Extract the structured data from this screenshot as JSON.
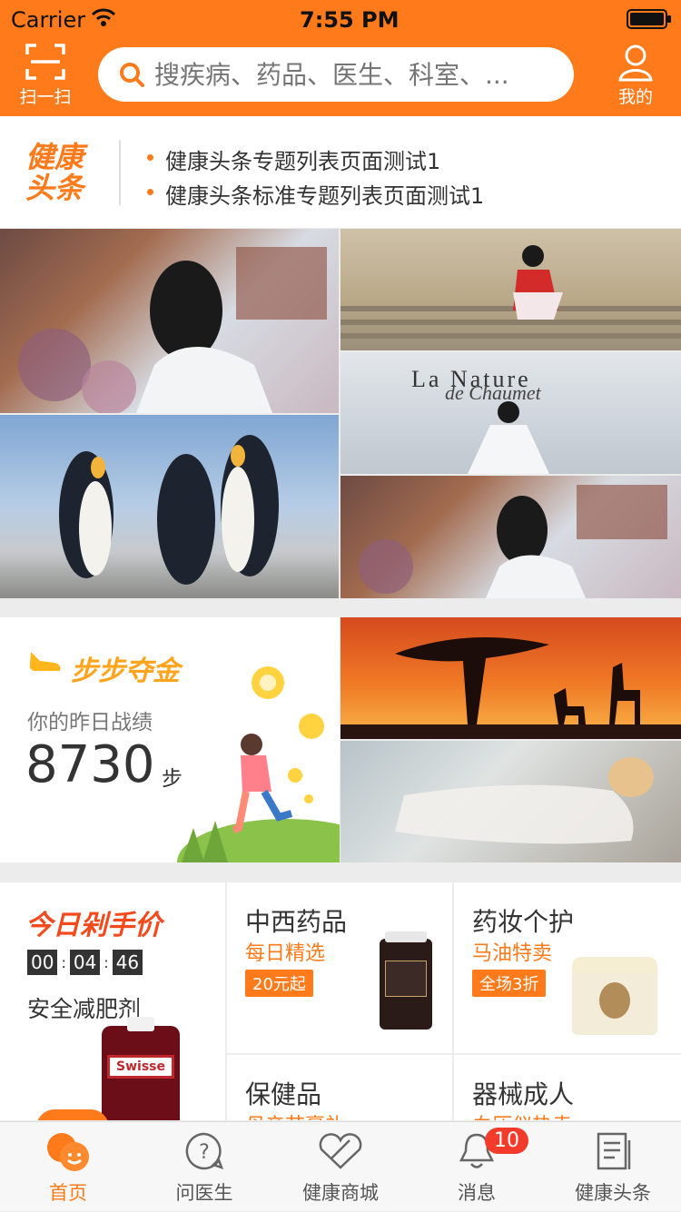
{
  "status_bar": {
    "carrier": "Carrier",
    "time": "7:55 PM"
  },
  "header": {
    "scan_label": "扫一扫",
    "search_placeholder": "搜疾病、药品、医生、科室、...",
    "profile_label": "我的"
  },
  "headline": {
    "logo_text": "健康头条",
    "items": [
      "健康头条专题列表页面测试1",
      "健康头条标准专题列表页面测试1"
    ]
  },
  "steps": {
    "title": "步步夺金",
    "subtitle": "你的昨日战绩",
    "count": "8730",
    "unit": "步"
  },
  "flash_sale": {
    "title": "今日剁手价",
    "timer": {
      "h": "00",
      "m": "04",
      "s": "46"
    },
    "product": "安全减肥剂",
    "product_brand": "Swisse"
  },
  "promos": [
    {
      "title": "中西药品",
      "sub": "每日精选",
      "tag": "20元起"
    },
    {
      "title": "药妆个护",
      "sub": "马油特卖",
      "tag": "全场3折"
    },
    {
      "title": "保健品",
      "sub": "母亲节豪礼"
    },
    {
      "title": "器械成人",
      "sub": "血压仪热卖"
    }
  ],
  "tabs": [
    {
      "label": "首页"
    },
    {
      "label": "问医生"
    },
    {
      "label": "健康商城"
    },
    {
      "label": "消息",
      "badge": "10"
    },
    {
      "label": "健康头条"
    }
  ],
  "colors": {
    "accent": "#ff7a1a",
    "badge": "#f23b2b"
  }
}
